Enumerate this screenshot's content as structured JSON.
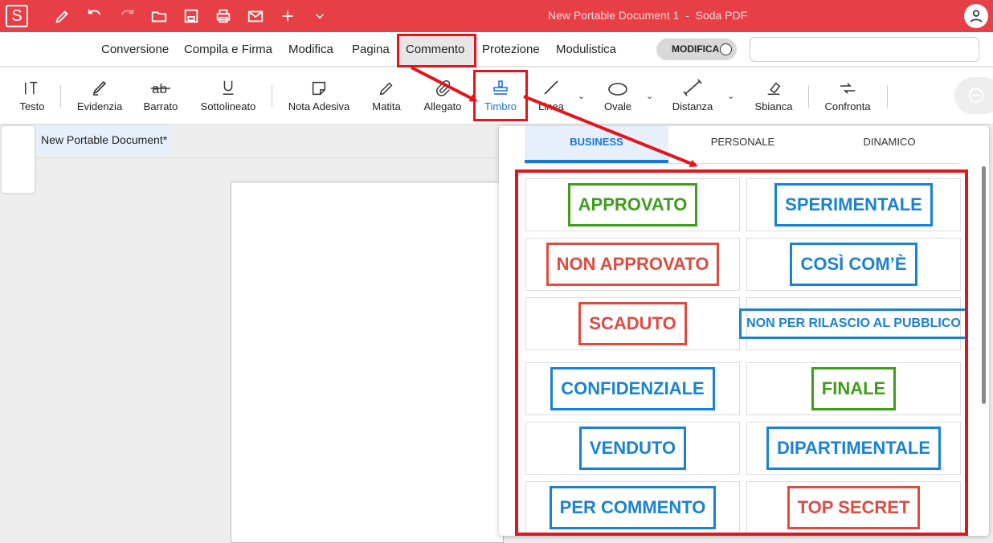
{
  "app": {
    "logo_letter": "S",
    "window_title": "New Portable Document 1  -  Soda PDF"
  },
  "menu": {
    "items": [
      "Conversione",
      "Compila e Firma",
      "Modifica",
      "Pagina",
      "Commento",
      "Protezione",
      "Modulistica"
    ],
    "active": "Commento",
    "mode_toggle_label": "MODIFICA"
  },
  "toolbar": {
    "tools": [
      "Testo",
      "Evidenzia",
      "Barrato",
      "Sottolineato",
      "Nota Adesiva",
      "Matita",
      "Allegato",
      "Timbro",
      "Linea",
      "Ovale",
      "Distanza",
      "Sbianca",
      "Confronta"
    ],
    "active": "Timbro"
  },
  "document": {
    "tab_title": "New Portable Document*"
  },
  "stamp_panel": {
    "tabs": [
      "BUSINESS",
      "PERSONALE",
      "DINAMICO"
    ],
    "active_tab": "BUSINESS",
    "stamps": [
      {
        "text": "APPROVATO",
        "color": "#3f9c1c"
      },
      {
        "text": "SPERIMENTALE",
        "color": "#1982d2"
      },
      {
        "text": "NON APPROVATO",
        "color": "#e04b3f"
      },
      {
        "text": "COSÌ COM’È",
        "color": "#1982d2"
      },
      {
        "text": "SCADUTO",
        "color": "#e04b3f"
      },
      {
        "text": "NON PER RILASCIO AL PUBBLICO",
        "color": "#1982d2"
      },
      {
        "text": "CONFIDENZIALE",
        "color": "#1982d2"
      },
      {
        "text": "FINALE",
        "color": "#3f9c1c"
      },
      {
        "text": "VENDUTO",
        "color": "#1982d2"
      },
      {
        "text": "DIPARTIMENTALE",
        "color": "#1982d2"
      },
      {
        "text": "PER COMMENTO",
        "color": "#1982d2"
      },
      {
        "text": "TOP SECRET",
        "color": "#e04b3f"
      }
    ]
  },
  "colors": {
    "brand": "#e63f45",
    "annotation": "#e5141b",
    "accent": "#1976d2"
  }
}
